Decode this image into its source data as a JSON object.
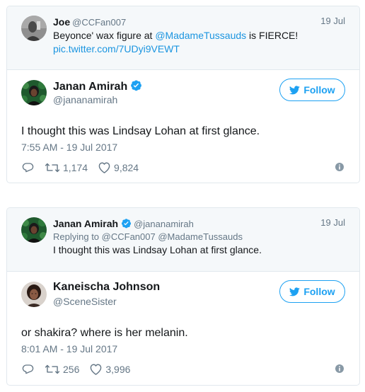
{
  "thread1": {
    "parent": {
      "name": "Joe",
      "handle": "@CCFan007",
      "date": "19 Jul",
      "text_before": "Beyonce' wax figure at ",
      "mention": "@MadameTussauds",
      "text_after": " is FIERCE!",
      "link": "pic.twitter.com/7UDyi9VEWT"
    },
    "main": {
      "name": "Janan Amirah",
      "handle": "@jananamirah",
      "follow_label": "Follow",
      "text": "I thought this was Lindsay Lohan at first glance.",
      "timestamp": "7:55 AM - 19 Jul 2017",
      "retweets": "1,174",
      "likes": "9,824"
    }
  },
  "thread2": {
    "parent": {
      "name": "Janan Amirah",
      "handle": "@jananamirah",
      "date": "19 Jul",
      "reply_prefix": "Replying to ",
      "reply_to": "@CCFan007 @MadameTussauds",
      "text": "I thought this was Lindsay Lohan at first glance."
    },
    "main": {
      "name": "Kaneischa Johnson",
      "handle": "@SceneSister",
      "follow_label": "Follow",
      "text": "or shakira? where is her melanin.",
      "timestamp": "8:01 AM - 19 Jul 2017",
      "retweets": "256",
      "likes": "3,996"
    }
  },
  "colors": {
    "twitter_blue": "#1da1f2",
    "link_blue": "#1b95e0",
    "muted": "#657786",
    "border": "#e1e8ed",
    "parent_bg": "#f5f8fa"
  },
  "icons": [
    "reply-icon",
    "retweet-icon",
    "heart-icon",
    "info-icon",
    "verified-icon",
    "twitter-bird-icon"
  ]
}
